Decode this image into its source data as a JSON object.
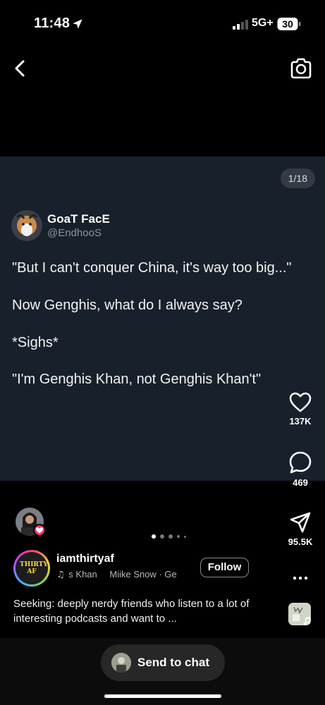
{
  "status_bar": {
    "time": "11:48",
    "network": "5G+",
    "battery": "30",
    "icons": [
      "location-arrow-icon",
      "signal-bars-icon",
      "battery-icon"
    ]
  },
  "nav": {
    "back_icon": "chevron-left-icon",
    "camera_icon": "camera-icon"
  },
  "tweet": {
    "page_counter": "1/18",
    "display_name": "GoaT FacE",
    "handle": "@EndhooS",
    "lines": [
      "\"But I can't conquer China, it's way too big...\"",
      "Now Genghis, what do I always say?",
      "*Sighs*",
      "\"I'm Genghis Khan, not Genghis Khan't\""
    ],
    "background": "#18202b"
  },
  "actions": {
    "likes": "137K",
    "comments": "469",
    "shares": "95.5K",
    "icons": [
      "heart-icon",
      "comment-bubble-icon",
      "paper-plane-icon",
      "more-dots-icon"
    ]
  },
  "post": {
    "username": "iamthirtyaf",
    "avatar_text": "THIRTY AF",
    "music_left": "s Khan",
    "music_right": "Miike Snow · Ge",
    "follow_label": "Follow",
    "caption": "Seeking: deeply nerdy friends who listen to a lot of interesting podcasts and want to ...",
    "carousel_dots": 5,
    "carousel_active": 0
  },
  "bottom": {
    "send_label": "Send to chat"
  },
  "colors": {
    "accent_like": "#ff2d6f",
    "card_bg": "#18202b"
  }
}
